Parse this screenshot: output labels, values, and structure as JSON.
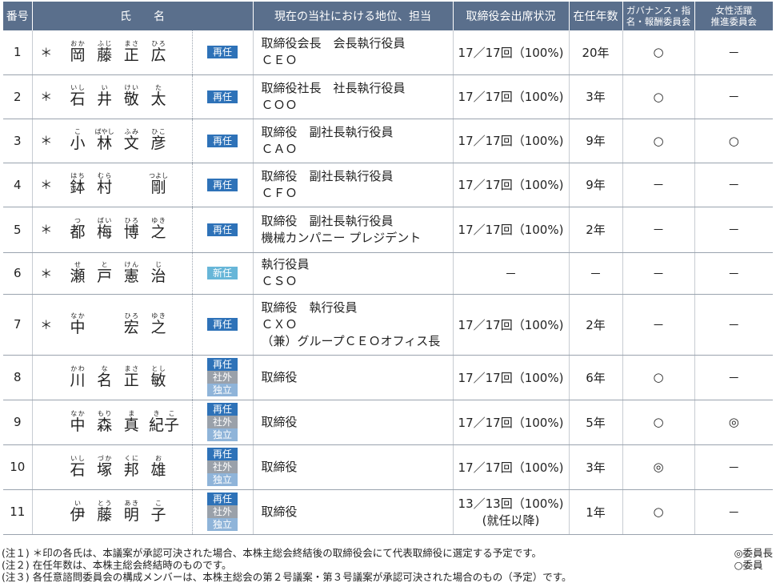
{
  "headers": {
    "number": "番号",
    "name": "氏　　名",
    "position": "現在の当社における地位、担当",
    "attendance": "取締役会出席状況",
    "tenure": "在任年数",
    "gov_line1": "ガバナンス・指",
    "gov_line2": "名・報酬委員会",
    "women_line1": "女性活躍",
    "women_line2": "推進委員会"
  },
  "rows": [
    {
      "num": "1",
      "mark": "＊",
      "name": [
        [
          "岡",
          "おか"
        ],
        [
          "藤",
          "ふじ"
        ],
        [
          "正",
          "まさ"
        ],
        [
          "広",
          "ひろ"
        ]
      ],
      "badges": [
        {
          "label": "再任",
          "type": "re"
        }
      ],
      "position": [
        "取締役会長　会長執行役員",
        "ＣＥＯ"
      ],
      "attendance": [
        "17／17回（100%)"
      ],
      "tenure": "20年",
      "gov": "○",
      "women": "－"
    },
    {
      "num": "2",
      "mark": "＊",
      "name": [
        [
          "石",
          "いし"
        ],
        [
          "井",
          "い"
        ],
        [
          "敬",
          "けい"
        ],
        [
          "太",
          "た"
        ]
      ],
      "badges": [
        {
          "label": "再任",
          "type": "re"
        }
      ],
      "position": [
        "取締役社長　社長執行役員",
        "ＣＯＯ"
      ],
      "attendance": [
        "17／17回（100%)"
      ],
      "tenure": "3年",
      "gov": "○",
      "women": "－"
    },
    {
      "num": "3",
      "mark": "＊",
      "name": [
        [
          "小",
          "こ"
        ],
        [
          "林",
          "ばやし"
        ],
        [
          "文",
          "ふみ"
        ],
        [
          "彦",
          "ひこ"
        ]
      ],
      "badges": [
        {
          "label": "再任",
          "type": "re"
        }
      ],
      "position": [
        "取締役　副社長執行役員",
        "ＣＡＯ"
      ],
      "attendance": [
        "17／17回（100%)"
      ],
      "tenure": "9年",
      "gov": "○",
      "women": "○"
    },
    {
      "num": "4",
      "mark": "＊",
      "name": [
        [
          "鉢",
          "はち"
        ],
        [
          "村",
          "むら"
        ],
        [
          "",
          ""
        ],
        [
          "剛",
          "つよし"
        ]
      ],
      "badges": [
        {
          "label": "再任",
          "type": "re"
        }
      ],
      "position": [
        "取締役　副社長執行役員",
        "ＣＦＯ"
      ],
      "attendance": [
        "17／17回（100%)"
      ],
      "tenure": "9年",
      "gov": "－",
      "women": "－"
    },
    {
      "num": "5",
      "mark": "＊",
      "name": [
        [
          "都",
          "つ"
        ],
        [
          "梅",
          "ばい"
        ],
        [
          "博",
          "ひろ"
        ],
        [
          "之",
          "ゆき"
        ]
      ],
      "badges": [
        {
          "label": "再任",
          "type": "re"
        }
      ],
      "position": [
        "取締役　副社長執行役員",
        "機械カンパニー プレジデント"
      ],
      "attendance": [
        "17／17回（100%)"
      ],
      "tenure": "2年",
      "gov": "－",
      "women": "－"
    },
    {
      "num": "6",
      "mark": "＊",
      "name": [
        [
          "瀬",
          "せ"
        ],
        [
          "戸",
          "と"
        ],
        [
          "憲",
          "けん"
        ],
        [
          "治",
          "じ"
        ]
      ],
      "badges": [
        {
          "label": "新任",
          "type": "new"
        }
      ],
      "position": [
        "執行役員",
        "ＣＳＯ"
      ],
      "attendance": [
        "－"
      ],
      "tenure": "－",
      "gov": "－",
      "women": "－"
    },
    {
      "num": "7",
      "mark": "＊",
      "name": [
        [
          "中",
          "なか"
        ],
        [
          "",
          ""
        ],
        [
          "宏",
          "ひろ"
        ],
        [
          "之",
          "ゆき"
        ]
      ],
      "badges": [
        {
          "label": "再任",
          "type": "re"
        }
      ],
      "position": [
        "取締役　執行役員",
        "ＣＸＯ",
        "（兼）グループＣＥＯオフィス長"
      ],
      "attendance": [
        "17／17回（100%)"
      ],
      "tenure": "2年",
      "gov": "－",
      "women": "－"
    },
    {
      "num": "8",
      "mark": "",
      "name": [
        [
          "川",
          "かわ"
        ],
        [
          "名",
          "な"
        ],
        [
          "正",
          "まさ"
        ],
        [
          "敏",
          "とし"
        ]
      ],
      "badges": [
        {
          "label": "再任",
          "type": "re"
        },
        {
          "label": "社外",
          "type": "out"
        },
        {
          "label": "独立",
          "type": "ind"
        }
      ],
      "position": [
        "取締役"
      ],
      "attendance": [
        "17／17回（100%)"
      ],
      "tenure": "6年",
      "gov": "○",
      "women": "－"
    },
    {
      "num": "9",
      "mark": "",
      "name": [
        [
          "中",
          "なか"
        ],
        [
          "森",
          "もり"
        ],
        [
          "真",
          "ま"
        ],
        [
          "紀子",
          "きこ"
        ]
      ],
      "badges": [
        {
          "label": "再任",
          "type": "re"
        },
        {
          "label": "社外",
          "type": "out"
        },
        {
          "label": "独立",
          "type": "ind"
        }
      ],
      "position": [
        "取締役"
      ],
      "attendance": [
        "17／17回（100%)"
      ],
      "tenure": "5年",
      "gov": "○",
      "women": "◎"
    },
    {
      "num": "10",
      "mark": "",
      "name": [
        [
          "石",
          "いし"
        ],
        [
          "塚",
          "づか"
        ],
        [
          "邦",
          "くに"
        ],
        [
          "雄",
          "お"
        ]
      ],
      "badges": [
        {
          "label": "再任",
          "type": "re"
        },
        {
          "label": "社外",
          "type": "out"
        },
        {
          "label": "独立",
          "type": "ind"
        }
      ],
      "position": [
        "取締役"
      ],
      "attendance": [
        "17／17回（100%)"
      ],
      "tenure": "3年",
      "gov": "◎",
      "women": "－"
    },
    {
      "num": "11",
      "mark": "",
      "name": [
        [
          "伊",
          "い"
        ],
        [
          "藤",
          "とう"
        ],
        [
          "明",
          "あき"
        ],
        [
          "子",
          "こ"
        ]
      ],
      "badges": [
        {
          "label": "再任",
          "type": "re"
        },
        {
          "label": "社外",
          "type": "out"
        },
        {
          "label": "独立",
          "type": "ind"
        }
      ],
      "position": [
        "取締役"
      ],
      "attendance": [
        "13／13回（100%)",
        "(就任以降)"
      ],
      "tenure": "1年",
      "gov": "○",
      "women": "－"
    }
  ],
  "notes": [
    "(注１) ＊印の各氏は、本議案が承認可決された場合、本株主総会終結後の取締役会にて代表取締役に選定する予定です。",
    "(注２) 在任年数は、本株主総会終結時のものです。",
    "(注３) 各任意諮問委員会の構成メンバーは、本株主総会の第２号議案・第３号議案が承認可決された場合のもの（予定）です。"
  ],
  "legend": [
    "◎委員長",
    "○委員"
  ],
  "colors": {
    "header_bg": "#5a6f8c",
    "badge_reappoint": "#2e72b8",
    "badge_new": "#67b6d8",
    "badge_outside": "#9aa1aa",
    "badge_independent": "#8fb4d9"
  }
}
